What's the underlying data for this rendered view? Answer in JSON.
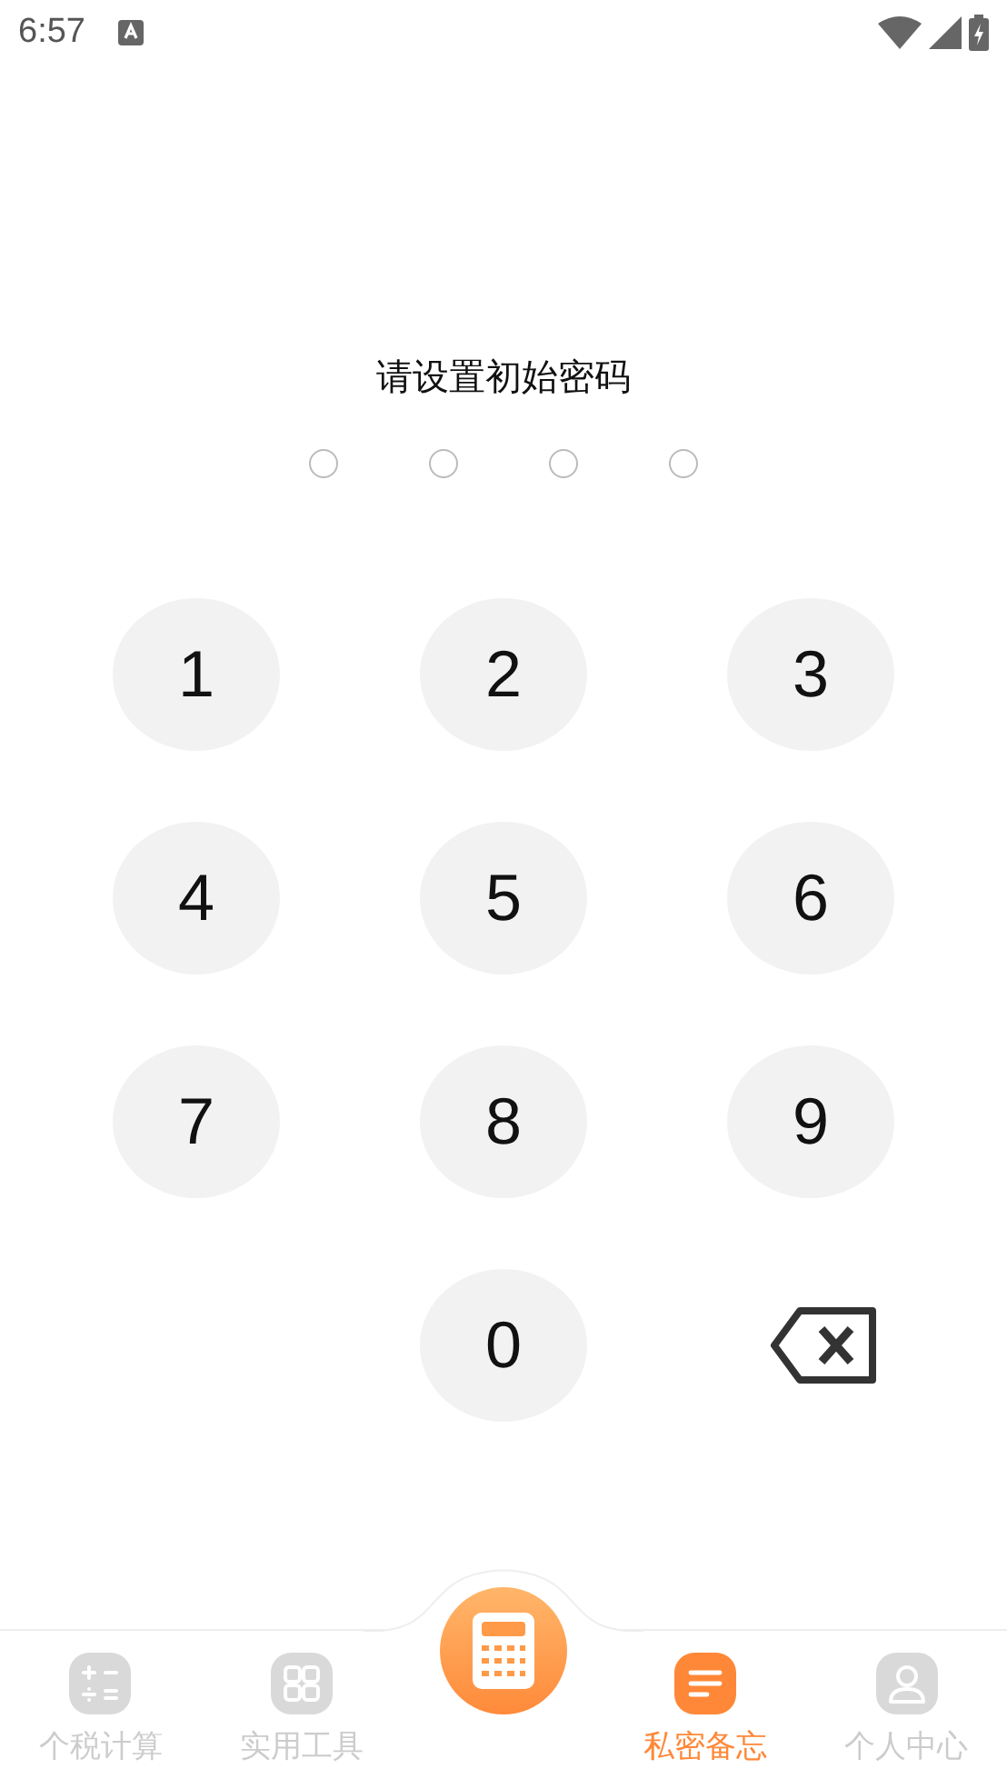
{
  "status_bar": {
    "time": "6:57"
  },
  "prompt": "请设置初始密码",
  "pin_dots": [
    {
      "filled": false
    },
    {
      "filled": false
    },
    {
      "filled": false
    },
    {
      "filled": false
    }
  ],
  "keys": [
    {
      "kind": "digit",
      "label": "1"
    },
    {
      "kind": "digit",
      "label": "2"
    },
    {
      "kind": "digit",
      "label": "3"
    },
    {
      "kind": "digit",
      "label": "4"
    },
    {
      "kind": "digit",
      "label": "5"
    },
    {
      "kind": "digit",
      "label": "6"
    },
    {
      "kind": "digit",
      "label": "7"
    },
    {
      "kind": "digit",
      "label": "8"
    },
    {
      "kind": "digit",
      "label": "9"
    },
    {
      "kind": "blank"
    },
    {
      "kind": "digit",
      "label": "0"
    },
    {
      "kind": "delete"
    }
  ],
  "tabs": [
    {
      "kind": "tab",
      "label": "个税计算",
      "selected": false
    },
    {
      "kind": "tab",
      "label": "实用工具",
      "selected": false
    },
    {
      "kind": "center"
    },
    {
      "kind": "tab",
      "label": "私密备忘",
      "selected": true
    },
    {
      "kind": "tab",
      "label": "个人中心",
      "selected": false
    }
  ]
}
